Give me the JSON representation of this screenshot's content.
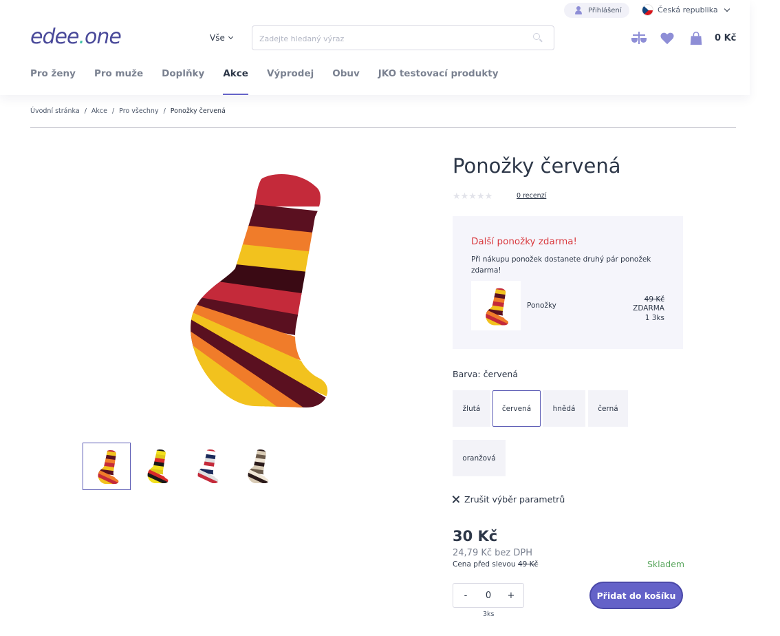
{
  "header": {
    "login_label": "Přihlášení",
    "country_label": "Česká republika",
    "logo": {
      "part1": "edee",
      "dot": ".",
      "part2": "one"
    },
    "category_select": "Vše",
    "search_placeholder": "Zadejte hledaný výraz",
    "cart_total": "0 Kč"
  },
  "nav": {
    "items": [
      {
        "label": "Pro ženy"
      },
      {
        "label": "Pro muže"
      },
      {
        "label": "Doplňky"
      },
      {
        "label": "Akce"
      },
      {
        "label": "Výprodej"
      },
      {
        "label": "Obuv"
      },
      {
        "label": "JKO testovací produkty"
      }
    ],
    "active_index": 3
  },
  "breadcrumb": {
    "items": [
      "Úvodní stránka",
      "Akce",
      "Pro všechny",
      "Ponožky červená"
    ],
    "separator": "/"
  },
  "gallery": {
    "thumb_count": 4,
    "selected_index": 0,
    "thumb_colors": [
      [
        "#c42a3a",
        "#f2c21e",
        "#5a1020",
        "#f07c2a"
      ],
      [
        "#1a1a1a",
        "#f2e01e",
        "#e0c81a",
        "#d92a2a"
      ],
      [
        "#c42a3a",
        "#ffffff",
        "#1a2a5a",
        "#e0e0e0"
      ],
      [
        "#2a1a1a",
        "#d8cbb5",
        "#6a5a4a",
        "#f0e6d6"
      ]
    ]
  },
  "product": {
    "title": "Ponožky červená",
    "rating_stars": "★★★★★",
    "reviews_link": "0 recenzí",
    "promo": {
      "title": "Další ponožky zdarma!",
      "text": "Při nákupu ponožek dostanete druhý pár ponožek zdarma!",
      "item_name": "Ponožky",
      "old_price": "49 Kč",
      "free_label": "ZDARMA",
      "qty": "1 3ks"
    },
    "color": {
      "label": "Barva:",
      "selected": "červená",
      "options": [
        "žlutá",
        "červená",
        "hnědá",
        "černá",
        "oranžová"
      ],
      "selected_index": 1
    },
    "clear_params": "Zrušit výběr parametrů",
    "price": "30 Kč",
    "price_net": "24,79 Kč bez DPH",
    "price_before_label": "Cena před slevou",
    "price_before_value": "49 Kč",
    "stock": "Skladem",
    "quantity": {
      "minus": "-",
      "value": "0",
      "plus": "+",
      "unit": "3ks"
    },
    "add_to_cart": "Přidat do košíku"
  },
  "colors": {
    "accent": "#6462c8",
    "promo_title": "#d9393e",
    "stock": "#58a55c",
    "icon": "#8e8ed6"
  }
}
